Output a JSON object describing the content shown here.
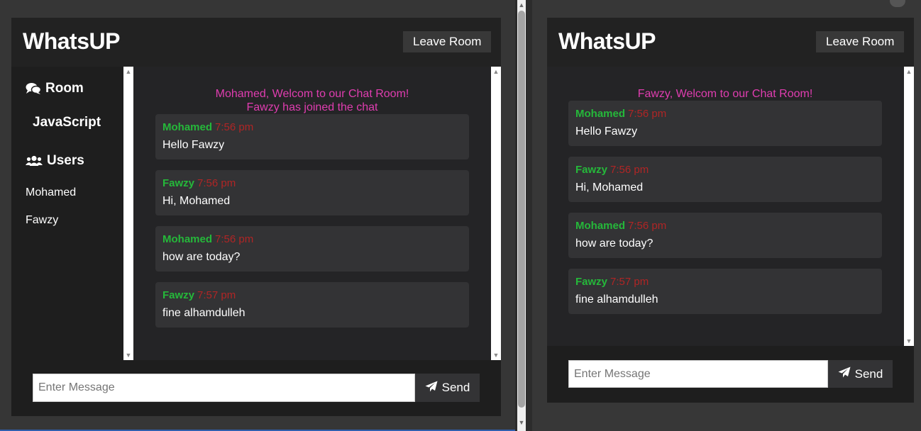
{
  "left": {
    "logo": "WhatsUP",
    "leave_label": "Leave Room",
    "sidebar": {
      "room_title": "Room",
      "room_name": "JavaScript",
      "users_title": "Users",
      "users": [
        "Mohamed",
        "Fawzy"
      ]
    },
    "system": [
      "Mohamed, Welcom to our Chat Room!",
      "Fawzy has joined the chat"
    ],
    "messages": [
      {
        "name": "Mohamed",
        "time": "7:56 pm",
        "text": "Hello Fawzy"
      },
      {
        "name": "Fawzy",
        "time": "7:56 pm",
        "text": "Hi, Mohamed"
      },
      {
        "name": "Mohamed",
        "time": "7:56 pm",
        "text": "how are today?"
      },
      {
        "name": "Fawzy",
        "time": "7:57 pm",
        "text": "fine alhamdulleh"
      }
    ],
    "input_placeholder": "Enter Message",
    "send_label": "Send"
  },
  "right": {
    "logo": "WhatsUP",
    "leave_label": "Leave Room",
    "system": [
      "Fawzy, Welcom to our Chat Room!"
    ],
    "messages": [
      {
        "name": "Mohamed",
        "time": "7:56 pm",
        "text": "Hello Fawzy"
      },
      {
        "name": "Fawzy",
        "time": "7:56 pm",
        "text": "Hi, Mohamed"
      },
      {
        "name": "Mohamed",
        "time": "7:56 pm",
        "text": "how are today?"
      },
      {
        "name": "Fawzy",
        "time": "7:57 pm",
        "text": "fine alhamdulleh"
      }
    ],
    "input_placeholder": "Enter Message",
    "send_label": "Send"
  },
  "colors": {
    "system_text": "#e03db0",
    "username": "#25b83a",
    "timestamp": "#b02525",
    "app_bg": "#1e1e1e"
  },
  "icons": {
    "room": "comments-icon",
    "users": "users-icon",
    "send": "paper-plane-icon",
    "more": "ellipsis-icon"
  }
}
